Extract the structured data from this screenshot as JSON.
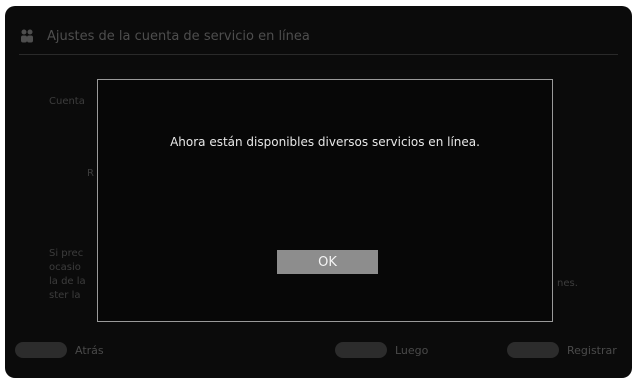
{
  "background": {
    "title": "Ajustes de la cuenta de servicio en línea",
    "section_label": "Cuenta",
    "row_fragment": "R",
    "paragraph_lines": [
      "Si prec",
      "ocasio",
      "la de la",
      "ster la"
    ],
    "right_fragment": "nes.",
    "footer": {
      "back_label": "Atrás",
      "next_label": "Luego",
      "register_label": "Registrar"
    }
  },
  "modal": {
    "message": "Ahora están disponibles diversos servicios en línea.",
    "ok_label": "OK"
  }
}
